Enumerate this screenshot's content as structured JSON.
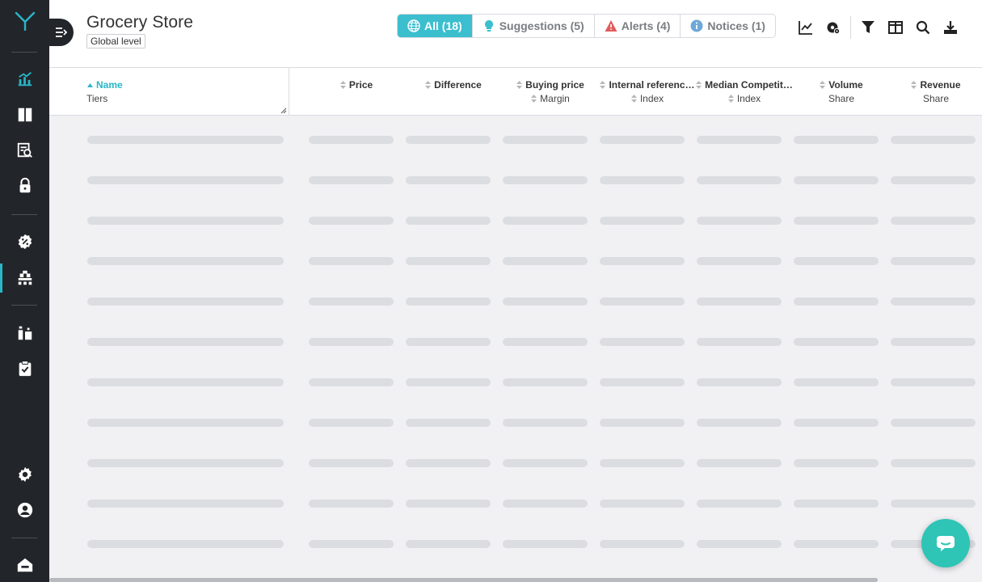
{
  "app": {
    "title": "Grocery Store",
    "level": "Global level"
  },
  "colors": {
    "accent": "#29b6c8",
    "sidebar": "#22262b",
    "chat": "#2ec4b6"
  },
  "sidebar": {
    "items": [
      {
        "icon": "analytics-icon",
        "active": false
      },
      {
        "icon": "columns-icon",
        "active": false
      },
      {
        "icon": "report-search-icon",
        "active": false
      },
      {
        "icon": "lock-icon",
        "active": false
      },
      {
        "icon": "discount-badge-icon",
        "active": false
      },
      {
        "icon": "tiers-icon",
        "active": true
      },
      {
        "icon": "products-icon",
        "active": false
      },
      {
        "icon": "clipboard-check-icon",
        "active": false
      },
      {
        "icon": "settings-icon",
        "active": false
      },
      {
        "icon": "user-icon",
        "active": false
      },
      {
        "icon": "store-icon",
        "active": false
      }
    ]
  },
  "filters": [
    {
      "label": "All (18)",
      "icon": "globe-icon",
      "active": true
    },
    {
      "label": "Suggestions (5)",
      "icon": "lightbulb-icon",
      "active": false
    },
    {
      "label": "Alerts (4)",
      "icon": "warning-icon",
      "active": false
    },
    {
      "label": "Notices (1)",
      "icon": "info-icon",
      "active": false
    }
  ],
  "toolbar": [
    "chart-icon",
    "settings-gear-icon",
    "filter-icon",
    "columns-layout-icon",
    "search-icon",
    "download-icon"
  ],
  "grid": {
    "name_column": {
      "label": "Name",
      "sub": "Tiers"
    },
    "columns": [
      {
        "label": "Price",
        "sub": ""
      },
      {
        "label": "Difference",
        "sub": ""
      },
      {
        "label": "Buying price",
        "sub": "Margin"
      },
      {
        "label": "Internal referenc…",
        "sub": "Index"
      },
      {
        "label": "Median Competit…",
        "sub": "Index"
      },
      {
        "label": "Volume",
        "sub": "Share"
      },
      {
        "label": "Revenue",
        "sub": "Share"
      }
    ],
    "loading_rows": 11
  }
}
